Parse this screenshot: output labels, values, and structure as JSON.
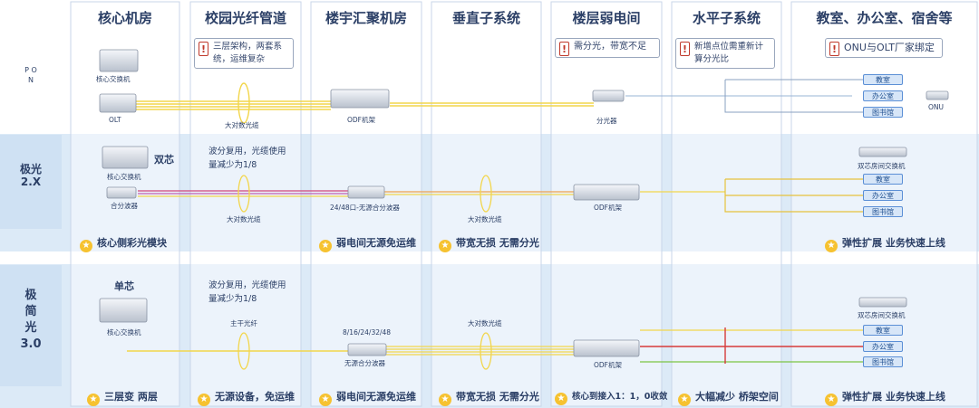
{
  "columns": [
    {
      "id": "core",
      "title": "核心机房"
    },
    {
      "id": "campus",
      "title": "校园光纤管道"
    },
    {
      "id": "building",
      "title": "楼宇汇聚机房"
    },
    {
      "id": "vertical",
      "title": "垂直子系统"
    },
    {
      "id": "floor",
      "title": "楼层弱电间"
    },
    {
      "id": "horizontal",
      "title": "水平子系统"
    },
    {
      "id": "rooms",
      "title": "教室、办公室、宿舍等"
    }
  ],
  "rows": {
    "pon": {
      "label": "P O N"
    },
    "jg2": {
      "label": "极光\n2.X"
    },
    "jjg3": {
      "label": "极\n简\n光\n3.0"
    }
  },
  "notes": {
    "campus": "三层架构，两套系统，运维复杂",
    "floor": "需分光，带宽不足",
    "horizontal": "新增点位需重新计算分光比",
    "rooms": "ONU与OLT厂家绑定"
  },
  "pon": {
    "core_switch": "核心交换机",
    "olt": "OLT",
    "cable": "大对数光缆",
    "odf": "ODF机架",
    "splitter": "分光器",
    "onu": "ONU",
    "rooms": [
      "教室",
      "办公室",
      "图书馆"
    ]
  },
  "jg2": {
    "core_switch": "核心交换机",
    "dual": "双芯",
    "mux": "合分波器",
    "wdm_text": "波分复用，光缆使用量减少为1/8",
    "cable": "大对数光缆",
    "passive_mux": "24/48口-无源合分波器",
    "vert_cable": "大对数光缆",
    "odf": "ODF机架",
    "room_switch": "双芯房间交换机",
    "rooms": [
      "教室",
      "办公室",
      "图书馆"
    ]
  },
  "jjg3": {
    "single": "单芯",
    "core_switch": "核心交换机",
    "wdm_text": "波分复用，光缆使用量减少为1/8",
    "trunk": "主干光纤",
    "ports": "8/16/24/32/48",
    "passive_mux": "无源合分波器",
    "vert_cable": "大对数光缆",
    "odf": "ODF机架",
    "room_switch": "双芯房间交换机",
    "rooms": [
      "教室",
      "办公室",
      "图书馆"
    ]
  },
  "footers": {
    "jg2": [
      {
        "col": "core",
        "text": "核心侧彩光模块"
      },
      {
        "col": "building",
        "text": "弱电间无源免运维"
      },
      {
        "col": "vertical",
        "text": "带宽无损 无需分光"
      },
      {
        "col": "rooms",
        "text": "弹性扩展 业务快速上线"
      }
    ],
    "jjg3": [
      {
        "col": "core",
        "text": "三层变 两层"
      },
      {
        "col": "campus",
        "text": "无源设备，免运维"
      },
      {
        "col": "building",
        "text": "弱电间无源免运维"
      },
      {
        "col": "vertical",
        "text": "带宽无损 无需分光"
      },
      {
        "col": "floor",
        "text": "核心到接入1：1，0收敛"
      },
      {
        "col": "horizontal",
        "text": "大幅减少 桥架空间"
      },
      {
        "col": "rooms",
        "text": "弹性扩展 业务快速上线"
      }
    ]
  },
  "colors": {
    "band": "#dceaf7",
    "panel_border": "#c9d6e8",
    "fiber_yellow": "#f2d64b",
    "fiber_pink": "#d0457a",
    "fiber_red": "#d63a3a",
    "fiber_green": "#7cc444",
    "room_pill": "#d7e6f8"
  }
}
